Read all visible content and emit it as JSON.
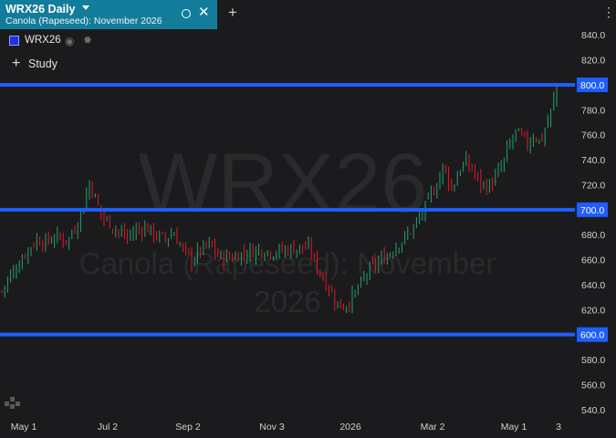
{
  "tab": {
    "title": "WRX26 Daily",
    "subtitle": "Canola (Rapeseed): November 2026"
  },
  "legend": {
    "symbol": "WRX26",
    "study_label": "Study"
  },
  "watermark": {
    "symbol": "WRX26",
    "line1": "Canola (Rapeseed): November",
    "line2": "2026"
  },
  "colors": {
    "up": "#26a269",
    "down": "#e01b24",
    "line": "#1f5eff",
    "background": "#1b1b1d",
    "tab": "#137c9b"
  },
  "icons": [
    "chevron-down-icon",
    "circle-icon",
    "close-icon",
    "plus-icon",
    "kebab-menu-icon",
    "eye-icon",
    "gear-icon",
    "logo-icon"
  ],
  "chart_data": {
    "type": "candlestick",
    "ylim": [
      534,
      846
    ],
    "y_ticks": [
      "840.0",
      "820.0",
      "800.0",
      "780.0",
      "760.0",
      "740.0",
      "720.0",
      "700.0",
      "680.0",
      "660.0",
      "640.0",
      "620.0",
      "600.0",
      "580.0",
      "560.0",
      "540.0"
    ],
    "x_ticks": [
      "May 1",
      "Jul 2",
      "Sep 2",
      "Nov 3",
      "2026",
      "Mar 2",
      "May 1",
      "3"
    ],
    "horizontal_lines": [
      {
        "label": "800.0",
        "value": 800
      },
      {
        "label": "700.0",
        "value": 700
      },
      {
        "label": "600.0",
        "value": 600
      }
    ],
    "close_path": [
      [
        0,
        632
      ],
      [
        10,
        646
      ],
      [
        20,
        656
      ],
      [
        30,
        668
      ],
      [
        40,
        676
      ],
      [
        50,
        674
      ],
      [
        60,
        678
      ],
      [
        75,
        676
      ],
      [
        85,
        690
      ],
      [
        92,
        704
      ],
      [
        98,
        722
      ],
      [
        105,
        708
      ],
      [
        112,
        694
      ],
      [
        120,
        690
      ],
      [
        130,
        682
      ],
      [
        140,
        678
      ],
      [
        150,
        684
      ],
      [
        160,
        686
      ],
      [
        170,
        680
      ],
      [
        180,
        676
      ],
      [
        190,
        682
      ],
      [
        200,
        668
      ],
      [
        210,
        660
      ],
      [
        220,
        668
      ],
      [
        230,
        672
      ],
      [
        240,
        662
      ],
      [
        255,
        662
      ],
      [
        270,
        666
      ],
      [
        285,
        668
      ],
      [
        300,
        666
      ],
      [
        315,
        668
      ],
      [
        330,
        670
      ],
      [
        340,
        668
      ],
      [
        345,
        658
      ],
      [
        352,
        648
      ],
      [
        360,
        638
      ],
      [
        368,
        626
      ],
      [
        375,
        622
      ],
      [
        385,
        628
      ],
      [
        395,
        640
      ],
      [
        405,
        652
      ],
      [
        415,
        658
      ],
      [
        425,
        664
      ],
      [
        435,
        672
      ],
      [
        445,
        678
      ],
      [
        455,
        688
      ],
      [
        465,
        700
      ],
      [
        472,
        712
      ],
      [
        480,
        722
      ],
      [
        486,
        736
      ],
      [
        490,
        728
      ],
      [
        495,
        716
      ],
      [
        502,
        730
      ],
      [
        510,
        738
      ],
      [
        518,
        732
      ],
      [
        525,
        722
      ],
      [
        535,
        718
      ],
      [
        545,
        728
      ],
      [
        552,
        738
      ],
      [
        558,
        752
      ],
      [
        565,
        762
      ],
      [
        572,
        758
      ],
      [
        578,
        752
      ],
      [
        585,
        760
      ],
      [
        592,
        754
      ],
      [
        600,
        770
      ],
      [
        606,
        784
      ],
      [
        610,
        800
      ],
      [
        612,
        804
      ]
    ]
  }
}
